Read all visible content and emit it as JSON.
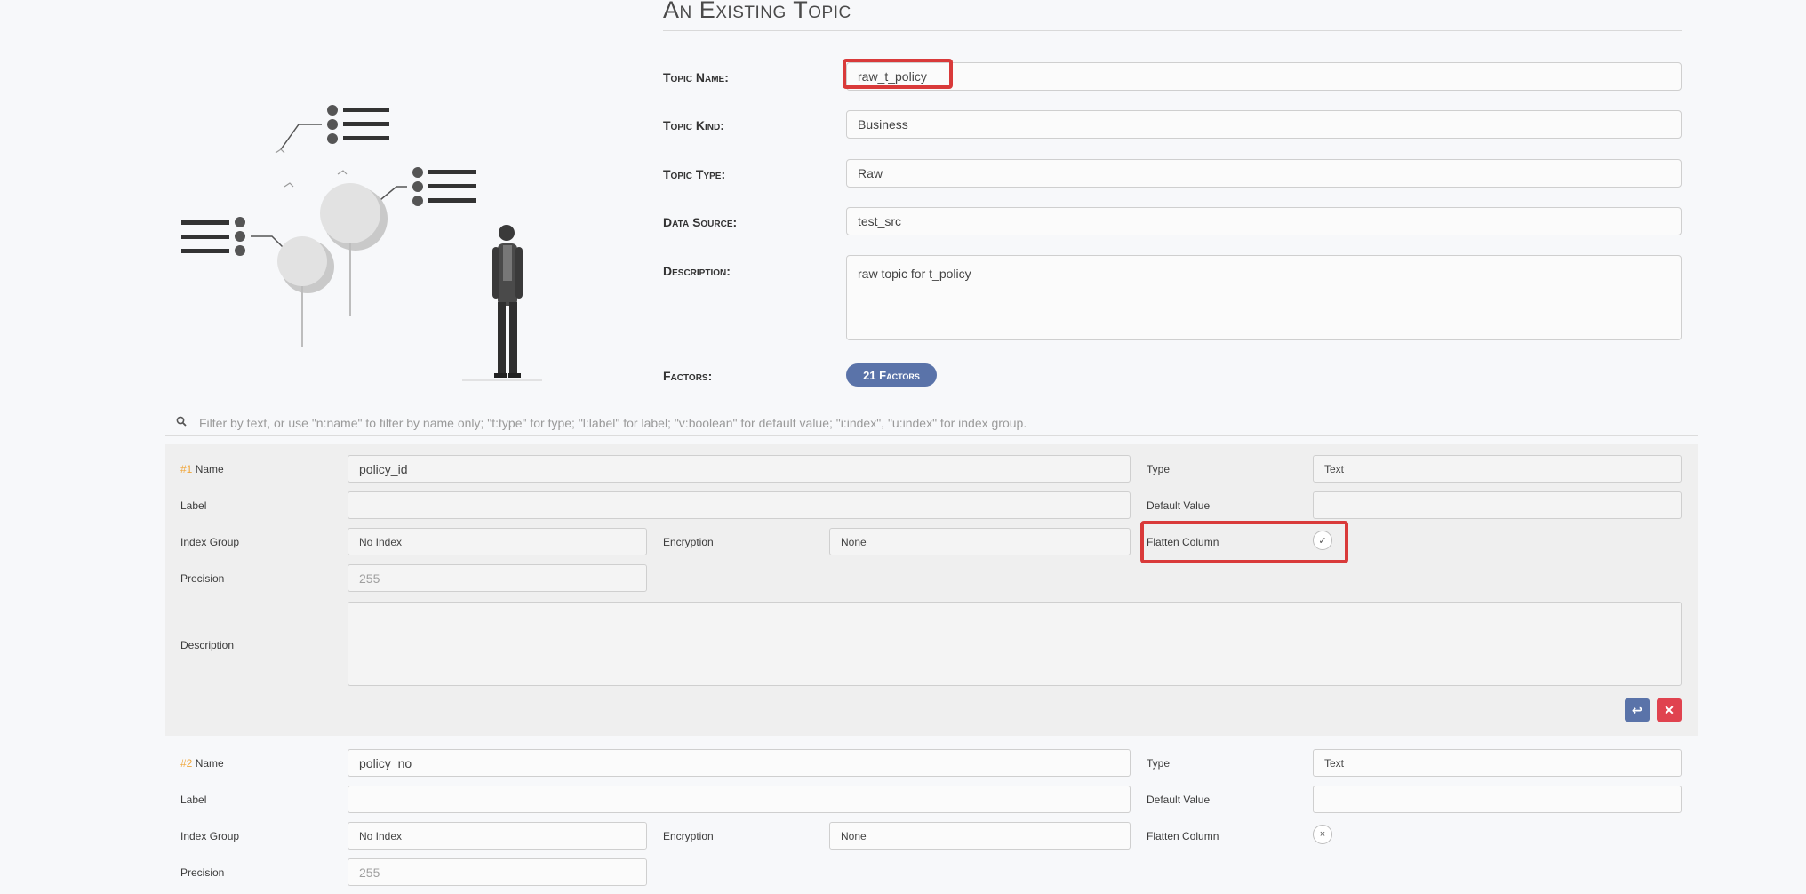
{
  "page": {
    "title": "An Existing Topic"
  },
  "topic": {
    "name_label": "Topic Name:",
    "name_value": "raw_t_policy",
    "kind_label": "Topic Kind:",
    "kind_value": "Business",
    "type_label": "Topic Type:",
    "type_value": "Raw",
    "source_label": "Data Source:",
    "source_value": "test_src",
    "description_label": "Description:",
    "description_value": "raw topic for t_policy",
    "factors_label": "Factors:",
    "factors_button": "21 Factors"
  },
  "filter": {
    "placeholder": "Filter by text, or use \"n:name\" to filter by name only; \"t:type\" for type; \"l:label\" for label; \"v:boolean\" for default value; \"i:index\", \"u:index\" for index group."
  },
  "factors": [
    {
      "index": "#1",
      "name_label": "Name",
      "name": "policy_id",
      "type_label": "Type",
      "type": "Text",
      "label_label": "Label",
      "label": "",
      "default_label": "Default Value",
      "default": "",
      "index_group_label": "Index Group",
      "index_group": "No Index",
      "encryption_label": "Encryption",
      "encryption": "None",
      "flatten_label": "Flatten Column",
      "flatten_symbol": "✓",
      "precision_label": "Precision",
      "precision": "255",
      "description_label": "Description",
      "description": ""
    },
    {
      "index": "#2",
      "name_label": "Name",
      "name": "policy_no",
      "type_label": "Type",
      "type": "Text",
      "label_label": "Label",
      "label": "",
      "default_label": "Default Value",
      "default": "",
      "index_group_label": "Index Group",
      "index_group": "No Index",
      "encryption_label": "Encryption",
      "encryption": "None",
      "flatten_label": "Flatten Column",
      "flatten_symbol": "×",
      "precision_label": "Precision",
      "precision": "255"
    }
  ],
  "actions": {
    "restore_symbol": "↩",
    "delete_symbol": "✕"
  },
  "colors": {
    "accent": "#5a73a9",
    "danger": "#e0434f",
    "highlight": "#d93a3a",
    "index_number": "#f0a63a"
  }
}
